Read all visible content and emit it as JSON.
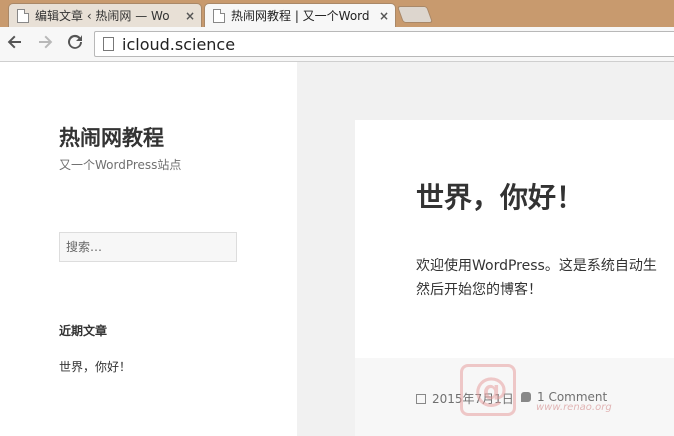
{
  "browser": {
    "tabs": [
      {
        "label": "编辑文章 ‹ 热闹网 — Wo",
        "close": "×"
      },
      {
        "label": "热闹网教程 | 又一个Word",
        "close": "×"
      }
    ],
    "url": "icloud.science",
    "icons": {
      "back": "arrow-left-icon",
      "forward": "arrow-right-icon",
      "reload": "reload-icon",
      "page": "page-icon"
    }
  },
  "sidebar": {
    "site_title": "热闹网教程",
    "site_description": "又一个WordPress站点",
    "search_placeholder": "搜索…",
    "recent_posts_title": "近期文章",
    "recent_posts": [
      "世界，你好！"
    ]
  },
  "post": {
    "title": "世界，你好！",
    "content_line1": "欢迎使用WordPress。这是系统自动生",
    "content_line2": "然后开始您的博客！",
    "date": "2015年7月1日",
    "comments": "1 Comment"
  },
  "watermark": {
    "text": "www.renao.org"
  }
}
